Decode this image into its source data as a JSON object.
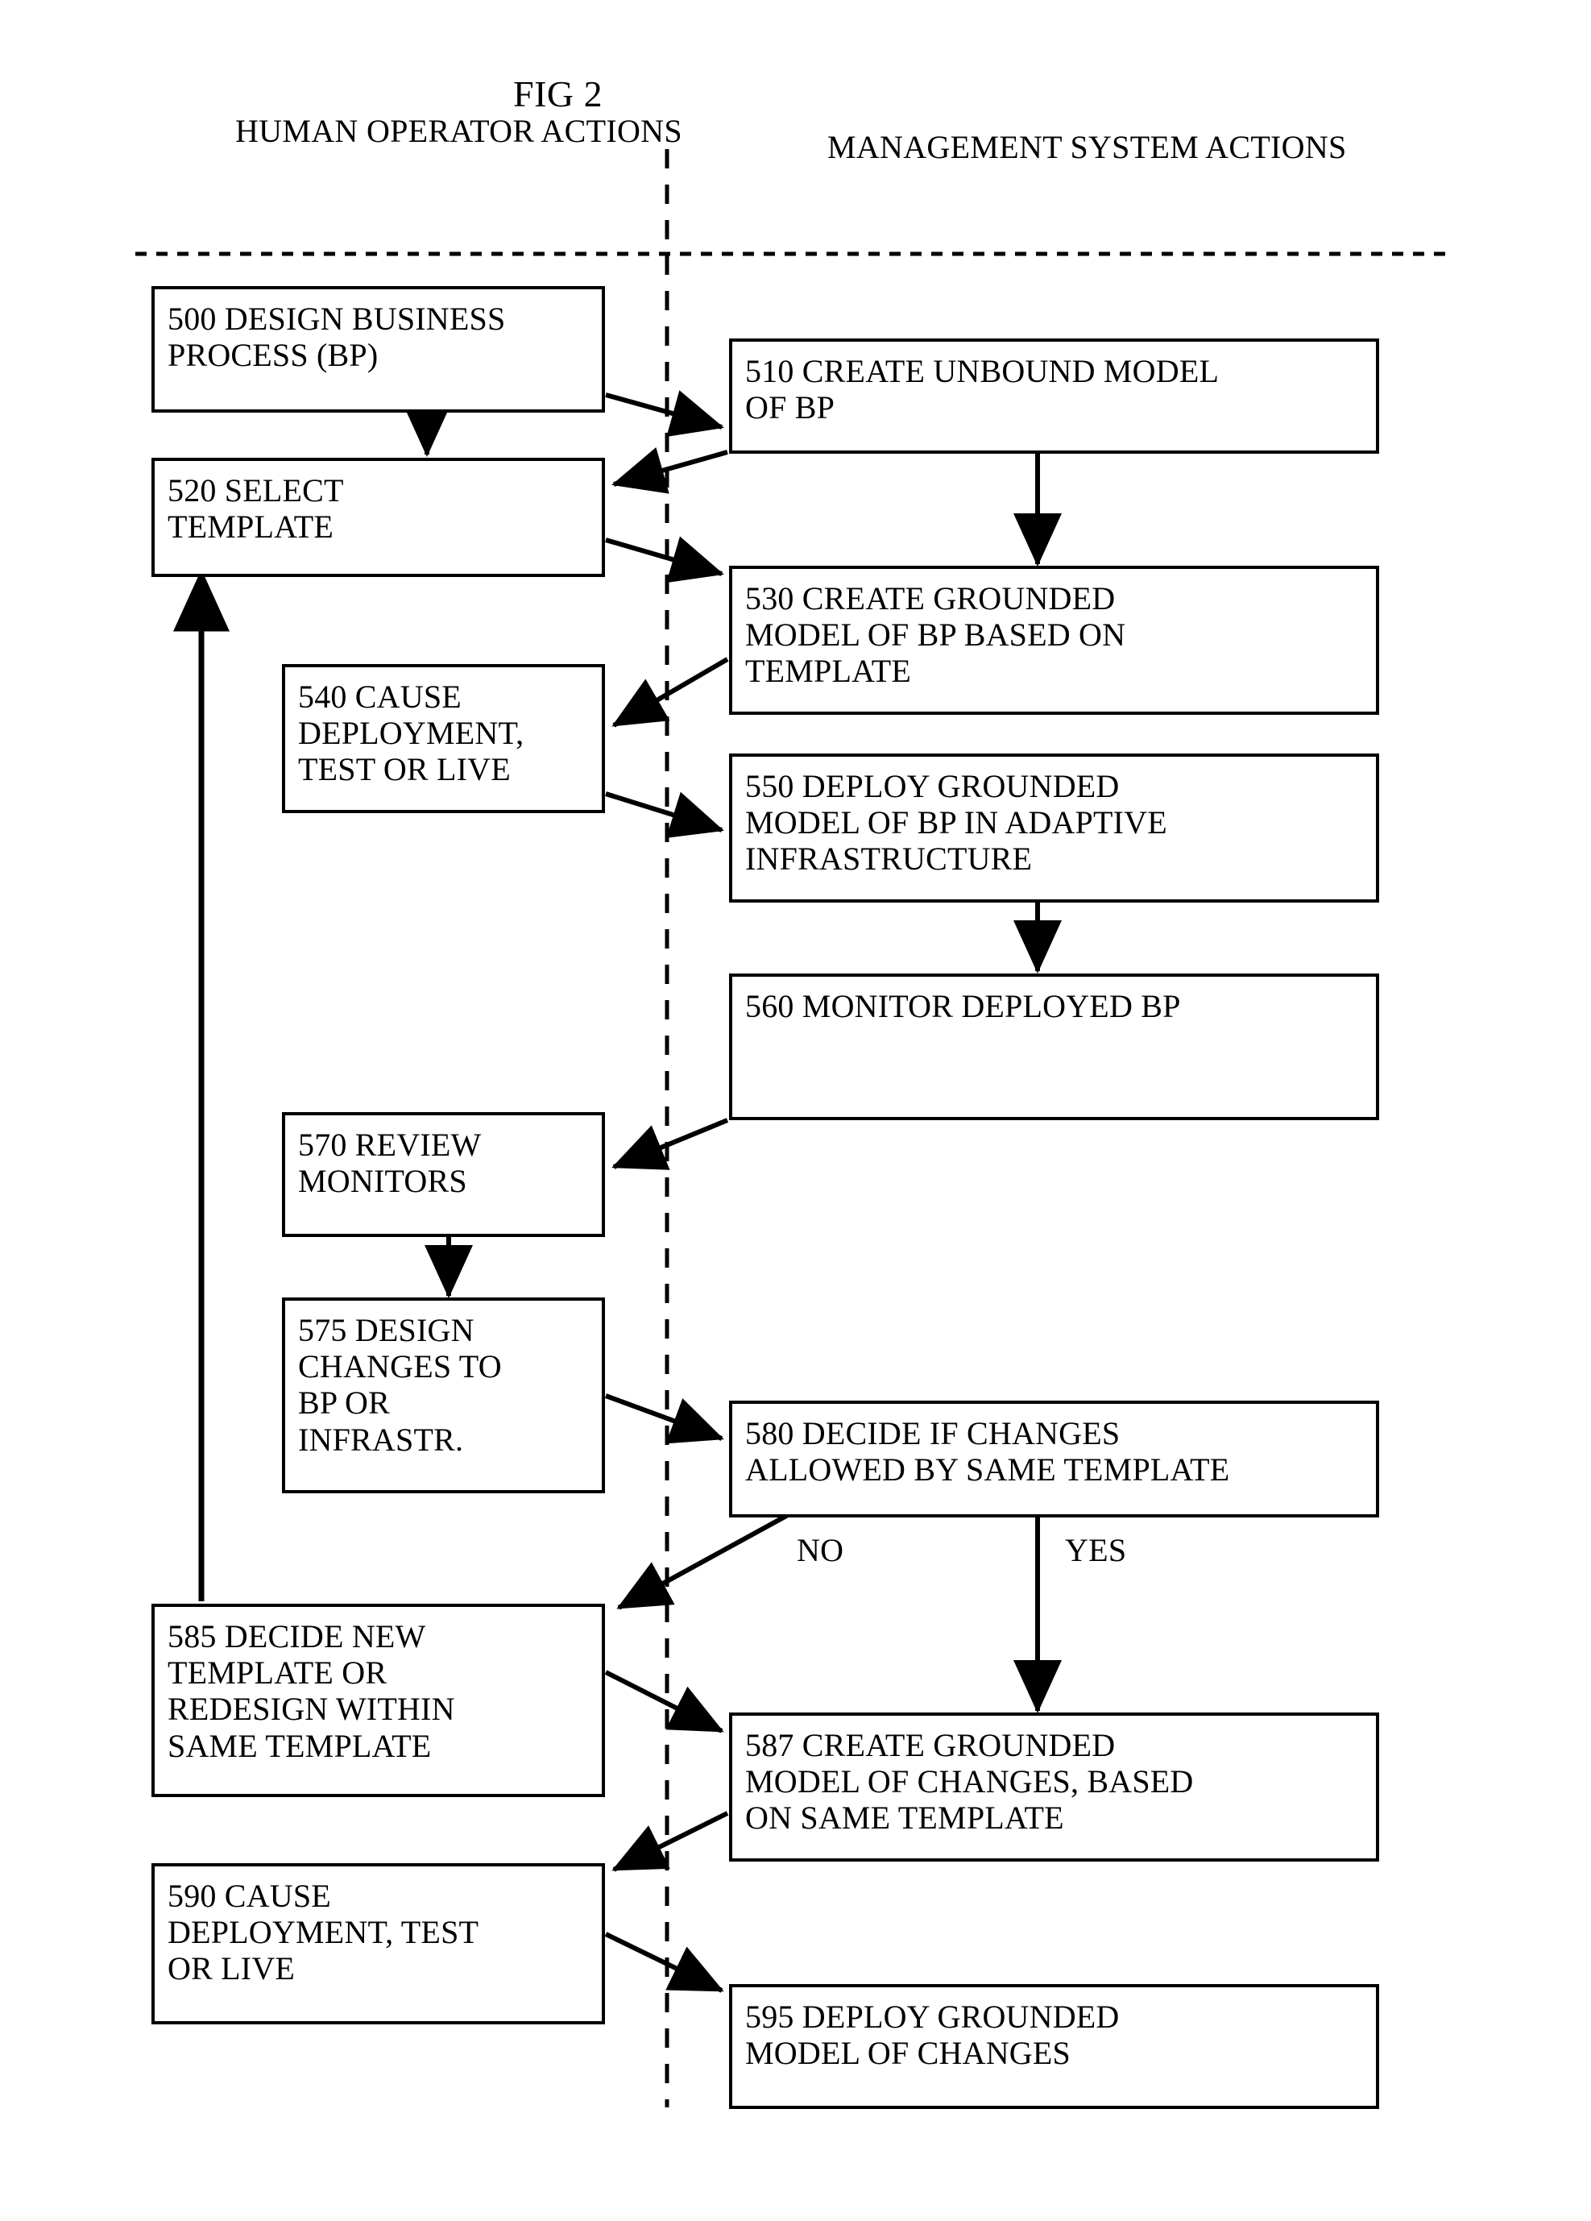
{
  "figure": {
    "title": "FIG 2"
  },
  "columns": [
    {
      "id": "human",
      "lines": [
        "HUMAN",
        "OPERATOR",
        "ACTIONS"
      ]
    },
    {
      "id": "system",
      "lines": [
        "MANAGEMENT SYSTEM",
        "ACTIONS"
      ]
    }
  ],
  "nodes": [
    {
      "id": "n500",
      "column": "human",
      "lines": [
        "500 DESIGN BUSINESS",
        "PROCESS (BP)"
      ]
    },
    {
      "id": "n510",
      "column": "system",
      "lines": [
        "510 CREATE UNBOUND MODEL",
        "OF BP"
      ]
    },
    {
      "id": "n520",
      "column": "human",
      "lines": [
        "520 SELECT",
        "TEMPLATE"
      ]
    },
    {
      "id": "n530",
      "column": "system",
      "lines": [
        "530 CREATE GROUNDED",
        "MODEL OF BP BASED ON",
        "TEMPLATE"
      ]
    },
    {
      "id": "n540",
      "column": "human",
      "lines": [
        "540 CAUSE",
        "DEPLOYMENT,",
        "TEST OR LIVE"
      ]
    },
    {
      "id": "n550",
      "column": "system",
      "lines": [
        "550 DEPLOY GROUNDED",
        "MODEL OF BP IN ADAPTIVE",
        "INFRASTRUCTURE"
      ]
    },
    {
      "id": "n560",
      "column": "system",
      "lines": [
        "560 MONITOR DEPLOYED BP"
      ]
    },
    {
      "id": "n570",
      "column": "human",
      "lines": [
        "570 REVIEW",
        "MONITORS"
      ]
    },
    {
      "id": "n575",
      "column": "human",
      "lines": [
        "575 DESIGN",
        "CHANGES TO",
        "BP OR",
        "INFRASTR."
      ]
    },
    {
      "id": "n580",
      "column": "system",
      "lines": [
        "580 DECIDE IF CHANGES",
        "ALLOWED BY SAME TEMPLATE"
      ]
    },
    {
      "id": "n585",
      "column": "human",
      "lines": [
        "585 DECIDE NEW",
        "TEMPLATE OR",
        "REDESIGN WITHIN",
        "SAME TEMPLATE"
      ]
    },
    {
      "id": "n587",
      "column": "system",
      "lines": [
        "587 CREATE GROUNDED",
        "MODEL OF CHANGES, BASED",
        "ON SAME TEMPLATE"
      ]
    },
    {
      "id": "n590",
      "column": "human",
      "lines": [
        "590 CAUSE",
        "DEPLOYMENT, TEST",
        "OR LIVE"
      ]
    },
    {
      "id": "n595",
      "column": "system",
      "lines": [
        "595 DEPLOY GROUNDED",
        "MODEL OF CHANGES"
      ]
    }
  ],
  "edge_labels": [
    {
      "id": "no",
      "text": "NO"
    },
    {
      "id": "yes",
      "text": "YES"
    }
  ],
  "colors": {
    "stroke": "#000000",
    "background": "#ffffff"
  }
}
